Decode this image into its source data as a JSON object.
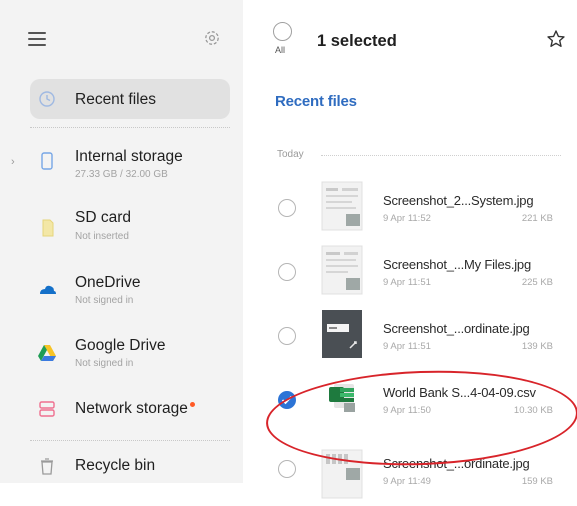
{
  "sidebar": {
    "items": [
      {
        "label": "Recent files",
        "sub": "",
        "icon": "clock-icon"
      },
      {
        "label": "Internal storage",
        "sub": "27.33 GB / 32.00 GB",
        "icon": "phone-icon"
      },
      {
        "label": "SD card",
        "sub": "Not inserted",
        "icon": "sd-card-icon"
      },
      {
        "label": "OneDrive",
        "sub": "Not signed in",
        "icon": "onedrive-icon"
      },
      {
        "label": "Google Drive",
        "sub": "Not signed in",
        "icon": "google-drive-icon"
      },
      {
        "label": "Network storage",
        "sub": "",
        "icon": "network-storage-icon"
      },
      {
        "label": "Recycle bin",
        "sub": "",
        "icon": "trash-icon"
      }
    ]
  },
  "header": {
    "all_label": "All",
    "selected_text": "1 selected"
  },
  "main": {
    "section_title": "Recent files",
    "day_label": "Today",
    "files": [
      {
        "name": "Screenshot_2...System.jpg",
        "date": "9 Apr 11:52",
        "size": "221 KB",
        "selected": false,
        "thumb": "screenshot-thumbnail"
      },
      {
        "name": "Screenshot_...My Files.jpg",
        "date": "9 Apr 11:51",
        "size": "225 KB",
        "selected": false,
        "thumb": "screenshot-thumbnail"
      },
      {
        "name": "Screenshot_...ordinate.jpg",
        "date": "9 Apr 11:51",
        "size": "139 KB",
        "selected": false,
        "thumb": "screenshot-thumbnail-dark"
      },
      {
        "name": "World Bank S...4-04-09.csv",
        "date": "9 Apr 11:50",
        "size": "10.30 KB",
        "selected": true,
        "thumb": "excel-csv-icon"
      },
      {
        "name": "Screenshot_...ordinate.jpg",
        "date": "9 Apr 11:49",
        "size": "159 KB",
        "selected": false,
        "thumb": "screenshot-thumbnail"
      }
    ]
  },
  "colors": {
    "accent": "#2f6cc0",
    "check": "#2c74d6",
    "annotation": "#d8242a",
    "badge": "#ff5a26",
    "sidebar_bg": "#f3f3f3"
  }
}
